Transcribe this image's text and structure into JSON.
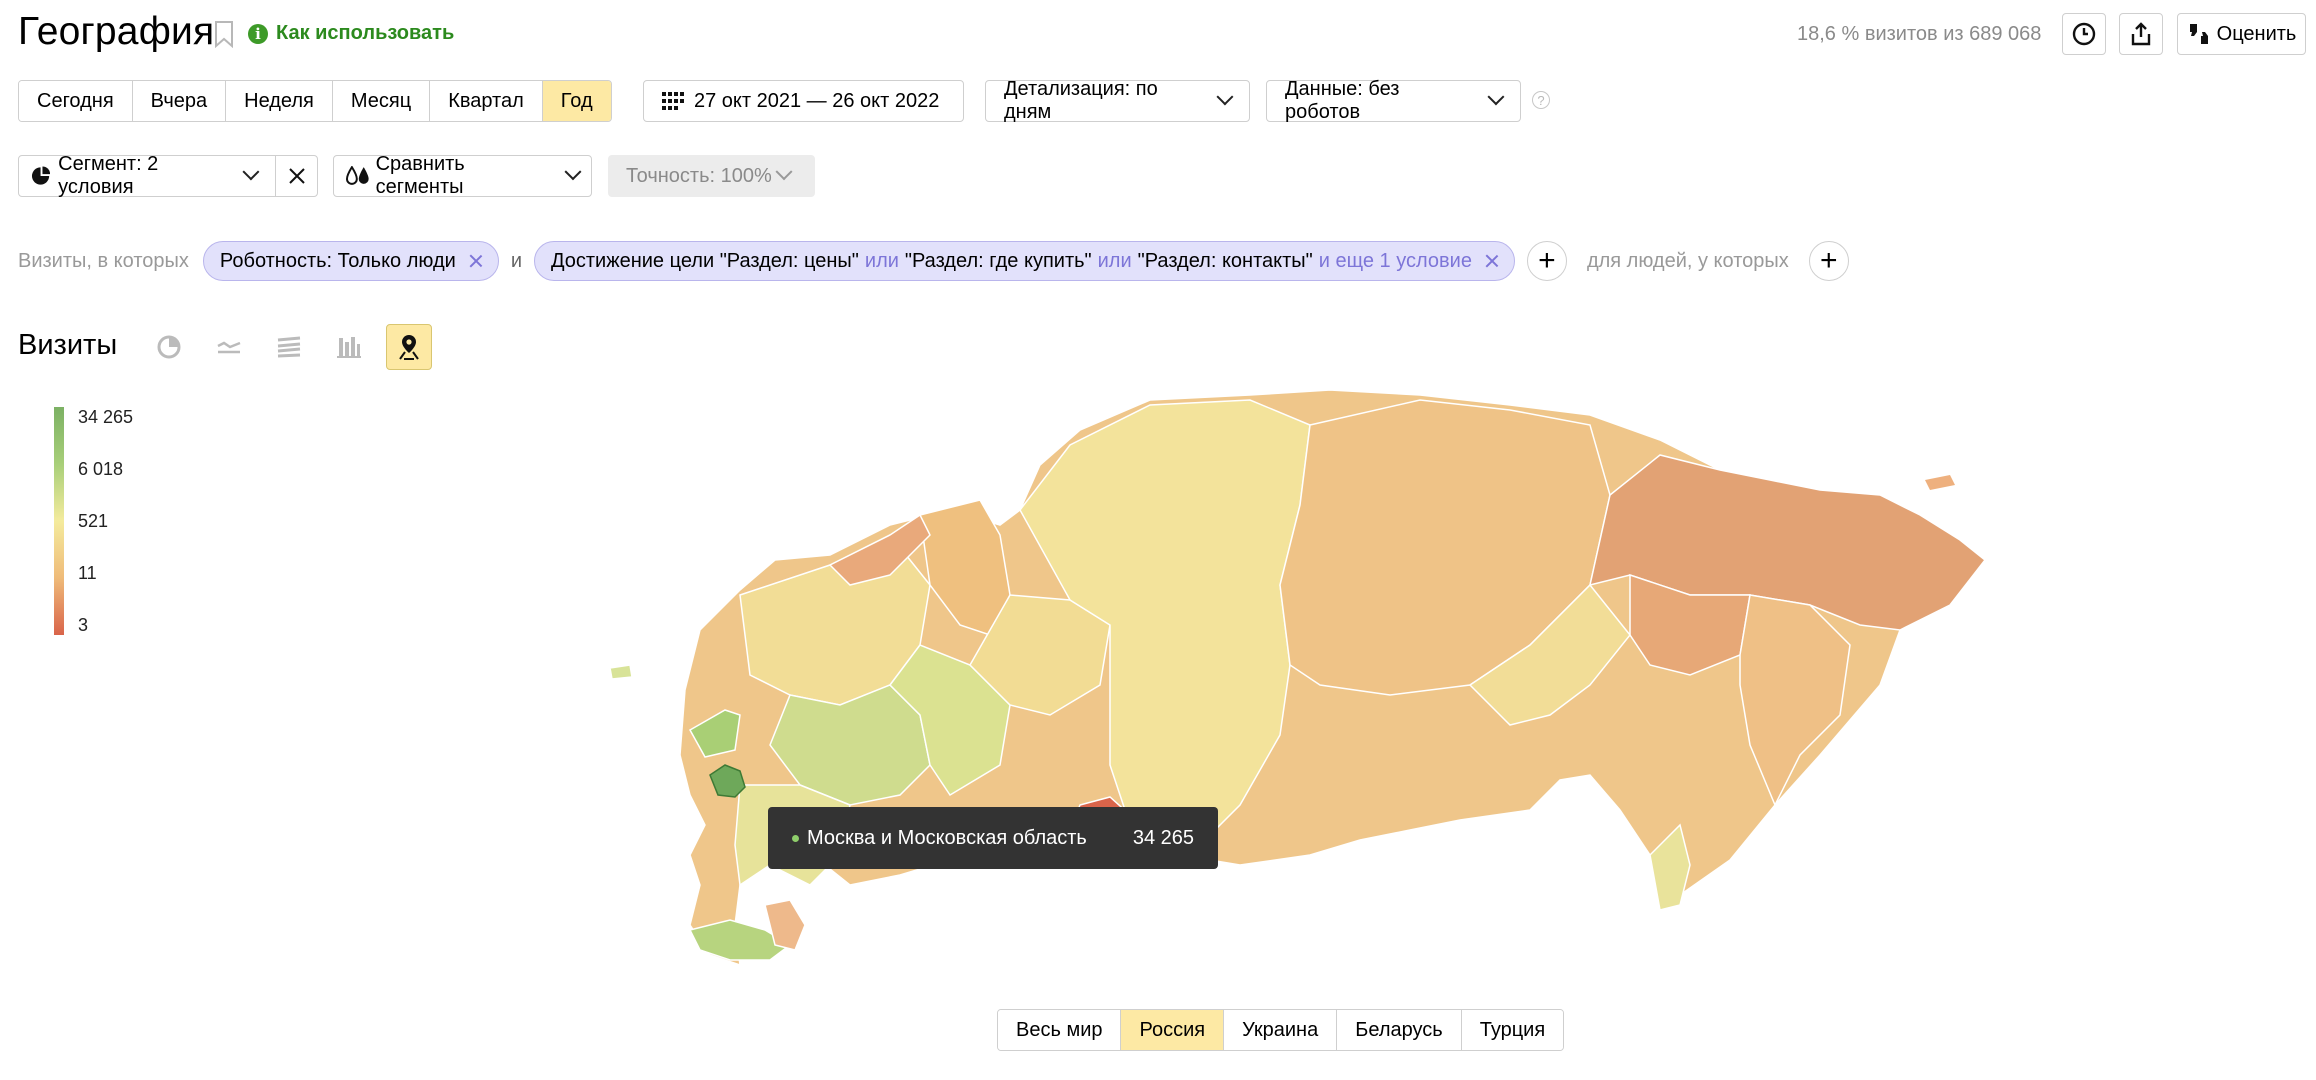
{
  "header": {
    "title": "География",
    "howto_label": "Как использовать",
    "visits_summary": "18,6 % визитов из 689 068",
    "rate_label": "Оценить"
  },
  "periods": [
    {
      "label": "Сегодня",
      "active": false
    },
    {
      "label": "Вчера",
      "active": false
    },
    {
      "label": "Неделя",
      "active": false
    },
    {
      "label": "Месяц",
      "active": false
    },
    {
      "label": "Квартал",
      "active": false
    },
    {
      "label": "Год",
      "active": true
    }
  ],
  "date_range": "27 окт 2021 — 26 окт 2022",
  "detail_label": "Детализация: по дням",
  "data_label": "Данные: без роботов",
  "segment": {
    "select_label": "Сегмент: 2 условия",
    "compare_label": "Сравнить сегменты",
    "accuracy_label": "Точность: 100%"
  },
  "conditions": {
    "prefix": "Визиты, в которых",
    "chip1": "Роботность: Только люди",
    "and_word": "и",
    "chip2_part1": "Достижение цели \"Раздел: цены\"",
    "chip2_or1": "или",
    "chip2_part2": "\"Раздел: где купить\"",
    "chip2_or2": "или",
    "chip2_part3": "\"Раздел: контакты\"",
    "chip2_more": "и еще 1 условие",
    "people_label": "для людей, у которых"
  },
  "section": {
    "title": "Визиты"
  },
  "legend": {
    "labels": [
      "34 265",
      "6 018",
      "521",
      "11",
      "3"
    ],
    "colors": [
      "#7cb164",
      "#a8cf79",
      "#f4eb9d",
      "#efbb79",
      "#d9644a"
    ]
  },
  "tooltip": {
    "region": "Москва и Московская область",
    "value": "34 265"
  },
  "countries": [
    {
      "label": "Весь мир",
      "active": false
    },
    {
      "label": "Россия",
      "active": true
    },
    {
      "label": "Украина",
      "active": false
    },
    {
      "label": "Беларусь",
      "active": false
    },
    {
      "label": "Турция",
      "active": false
    }
  ]
}
